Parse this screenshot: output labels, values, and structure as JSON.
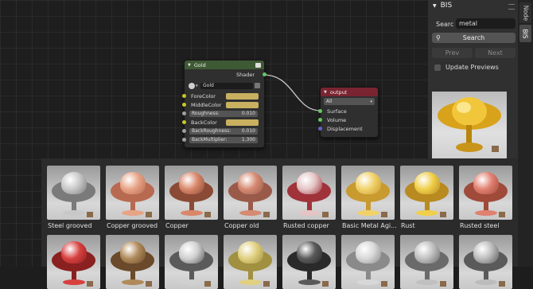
{
  "gold_node": {
    "title": "Gold",
    "output_label": "Shader",
    "material_name": "Gold",
    "rows": [
      {
        "label": "ForeColor",
        "value": ""
      },
      {
        "label": "MiddleColor",
        "value": ""
      },
      {
        "label": "Roughness:",
        "value": "0.010"
      },
      {
        "label": "BackColor",
        "value": ""
      },
      {
        "label": "BackRoughness:",
        "value": "0.010"
      },
      {
        "label": "BackMultiplier:",
        "value": "1.300"
      }
    ]
  },
  "output_node": {
    "title": "output",
    "target": "All",
    "sockets": [
      "Surface",
      "Volume",
      "Displacement"
    ]
  },
  "panel": {
    "title": "BIS",
    "search_label": "Searc",
    "search_value": "metal",
    "search_button": "Search",
    "prev_button": "Prev",
    "next_button": "Next",
    "update_previews_label": "Update Previews"
  },
  "tabs": [
    {
      "label": "Node"
    },
    {
      "label": "BIS"
    }
  ],
  "materials_row1": [
    {
      "name": "Steel grooved",
      "color": "#c8c8c8",
      "dark": "#7a7a7a"
    },
    {
      "name": "Copper grooved",
      "color": "#e7a386",
      "dark": "#b86a50"
    },
    {
      "name": "Copper",
      "color": "#d9876a",
      "dark": "#8a4a35"
    },
    {
      "name": "Copper old",
      "color": "#d58a72",
      "dark": "#9a5a4a"
    },
    {
      "name": "Rusted copper",
      "color": "#e4c4c4",
      "dark": "#a0323a"
    },
    {
      "name": "Basic Metal Agi...",
      "color": "#f1d26a",
      "dark": "#c89a30"
    },
    {
      "name": "Rust",
      "color": "#f0cf4a",
      "dark": "#b88a20"
    },
    {
      "name": "Rusted steel",
      "color": "#e08070",
      "dark": "#a04a3a"
    }
  ],
  "materials_row2": [
    {
      "name": "",
      "color": "#d84040",
      "dark": "#8a2020"
    },
    {
      "name": "",
      "color": "#b08a5a",
      "dark": "#6a4a2a"
    },
    {
      "name": "",
      "color": "#d0d0d0",
      "dark": "#5a5a5a"
    },
    {
      "name": "",
      "color": "#e0d080",
      "dark": "#a09040"
    },
    {
      "name": "",
      "color": "#5a5a5a",
      "dark": "#2a2a2a"
    },
    {
      "name": "",
      "color": "#d8d8d8",
      "dark": "#8a8a8a"
    },
    {
      "name": "",
      "color": "#c0c0c0",
      "dark": "#6a6a6a"
    },
    {
      "name": "",
      "color": "#bcbcbc",
      "dark": "#5a5a5a"
    }
  ]
}
